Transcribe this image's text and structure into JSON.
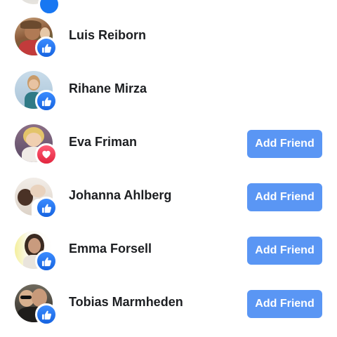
{
  "reactions": {
    "people": [
      {
        "name": "Luis Reiborn",
        "reaction": "like-icon",
        "action_label": ""
      },
      {
        "name": "Rihane Mirza",
        "reaction": "like-icon",
        "action_label": ""
      },
      {
        "name": "Eva Friman",
        "reaction": "love-icon",
        "action_label": "Add Friend"
      },
      {
        "name": "Johanna Ahlberg",
        "reaction": "like-icon",
        "action_label": "Add Friend"
      },
      {
        "name": "Emma Forsell",
        "reaction": "like-icon",
        "action_label": "Add Friend"
      },
      {
        "name": "Tobias Marmheden",
        "reaction": "like-icon",
        "action_label": "Add Friend"
      }
    ]
  },
  "colors": {
    "like": "#1877f2",
    "love": "#e2263f",
    "add_friend_button": "#5a96f4",
    "name_text": "#1c1e21"
  }
}
